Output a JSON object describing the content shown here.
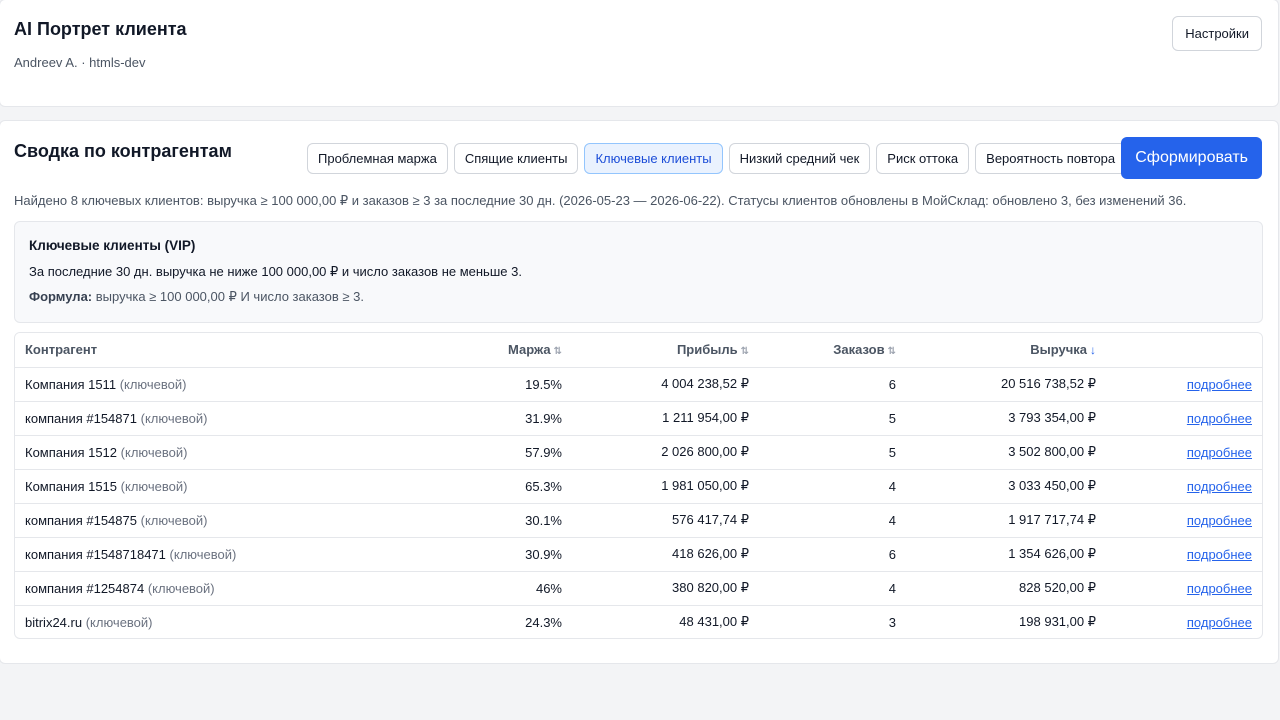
{
  "header": {
    "title": "AI Портрет клиента",
    "subtitle": "Andreev A. · htmls-dev",
    "settings_label": "Настройки"
  },
  "section": {
    "title": "Сводка по контрагентам",
    "tabs": [
      {
        "label": "Проблемная маржа",
        "active": false
      },
      {
        "label": "Спящие клиенты",
        "active": false
      },
      {
        "label": "Ключевые клиенты",
        "active": true
      },
      {
        "label": "Низкий средний чек",
        "active": false
      },
      {
        "label": "Риск оттока",
        "active": false
      },
      {
        "label": "Вероятность повтора",
        "active": false
      }
    ],
    "generate_label": "Сформировать",
    "summary": "Найдено 8 ключевых клиентов: выручка ≥ 100 000,00 ₽ и заказов ≥ 3 за последние 30 дн. (2026-05-23 — 2026-06-22). Статусы клиентов обновлены в МойСклад: обновлено 3, без изменений 36."
  },
  "info": {
    "title": "Ключевые клиенты (VIP)",
    "description": "За последние 30 дн. выручка не ниже 100 000,00 ₽ и число заказов не меньше 3.",
    "formula_label": "Формула:",
    "formula_text": " выручка ≥ 100 000,00 ₽ И число заказов ≥ 3."
  },
  "table": {
    "columns": {
      "name": "Контрагент",
      "margin": "Маржа",
      "profit": "Прибыль",
      "orders": "Заказов",
      "revenue": "Выручка"
    },
    "sort_icons": {
      "inactive": "⇅",
      "active": "↓"
    },
    "tag": "(ключевой)",
    "link_label": "подробнее",
    "rows": [
      {
        "name": "Компания 1511",
        "margin": "19.5%",
        "profit": "4 004 238,52 ₽",
        "orders": "6",
        "revenue": "20 516 738,52 ₽"
      },
      {
        "name": "компания #154871",
        "margin": "31.9%",
        "profit": "1 211 954,00 ₽",
        "orders": "5",
        "revenue": "3 793 354,00 ₽"
      },
      {
        "name": "Компания 1512",
        "margin": "57.9%",
        "profit": "2 026 800,00 ₽",
        "orders": "5",
        "revenue": "3 502 800,00 ₽"
      },
      {
        "name": "Компания 1515",
        "margin": "65.3%",
        "profit": "1 981 050,00 ₽",
        "orders": "4",
        "revenue": "3 033 450,00 ₽"
      },
      {
        "name": "компания #154875",
        "margin": "30.1%",
        "profit": "576 417,74 ₽",
        "orders": "4",
        "revenue": "1 917 717,74 ₽"
      },
      {
        "name": "компания #1548718471",
        "margin": "30.9%",
        "profit": "418 626,00 ₽",
        "orders": "6",
        "revenue": "1 354 626,00 ₽"
      },
      {
        "name": "компания #1254874",
        "margin": "46%",
        "profit": "380 820,00 ₽",
        "orders": "4",
        "revenue": "828 520,00 ₽"
      },
      {
        "name": "bitrix24.ru",
        "margin": "24.3%",
        "profit": "48 431,00 ₽",
        "orders": "3",
        "revenue": "198 931,00 ₽"
      }
    ]
  },
  "colors": {
    "accent": "#2563eb",
    "active_tab_bg": "#eaf2fe",
    "page_bg": "#f3f4f6"
  }
}
